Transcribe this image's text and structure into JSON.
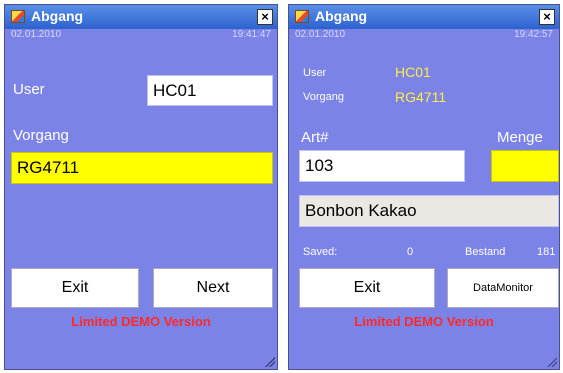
{
  "left_window": {
    "title": "Abgang",
    "close": "×",
    "date": "02.01.2010",
    "time": "19:41:47",
    "user_label": "User",
    "user_value": "HC01",
    "vorgang_label": "Vorgang",
    "vorgang_value": "RG4711",
    "exit_label": "Exit",
    "next_label": "Next",
    "demo_text": "Limited DEMO Version"
  },
  "right_window": {
    "title": "Abgang",
    "close": "×",
    "date": "02.01.2010",
    "time": "19:42:57",
    "user_label": "User",
    "user_value": "HC01",
    "vorgang_label": "Vorgang",
    "vorgang_value": "RG4711",
    "art_label": "Art#",
    "art_value": "103",
    "menge_label": "Menge",
    "menge_value": "",
    "product_name": "Bonbon Kakao",
    "saved_label": "Saved:",
    "saved_value": "0",
    "bestand_label": "Bestand",
    "bestand_value": "181",
    "exit_label": "Exit",
    "datamonitor_label": "DataMonitor",
    "demo_text": "Limited DEMO Version"
  }
}
